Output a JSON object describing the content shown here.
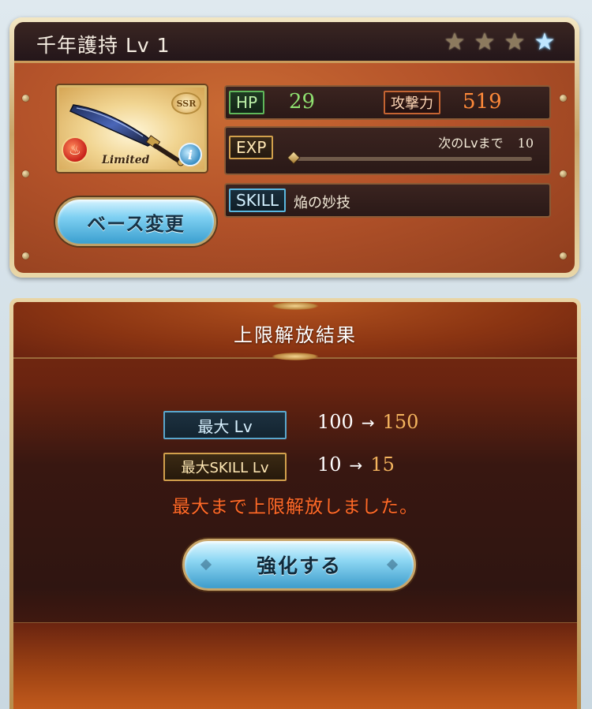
{
  "weapon_card": {
    "name_level": "千年護持 Lv 1",
    "rarity_badge": "SSR",
    "limited_label": "Limited",
    "base_change_label": "ベース変更",
    "stars": [
      {
        "type": "uncap",
        "color": "#8c7a5e"
      },
      {
        "type": "uncap",
        "color": "#8c7a5e"
      },
      {
        "type": "uncap",
        "color": "#8c7a5e"
      },
      {
        "type": "transcend",
        "color": "#bfe6ff"
      }
    ],
    "stats": {
      "hp_label": "HP",
      "hp_value": "29",
      "atk_label": "攻撃力",
      "atk_value": "519",
      "exp_label": "EXP",
      "next_level_label": "次のLvまで",
      "next_level_value": "10",
      "exp_progress": 0.0,
      "skill_label": "SKILL",
      "skill_name": "焔の妙技"
    },
    "element_icon": "fire-icon",
    "info_icon": "info-icon"
  },
  "result_dialog": {
    "title": "上限解放結果",
    "max_level_label": "最大 Lv",
    "max_level_old": "100",
    "max_level_arrow": "→",
    "max_level_new": "150",
    "max_skill_label": "最大SKILL Lv",
    "max_skill_old": "10",
    "max_skill_arrow": "→",
    "max_skill_new": "15",
    "message": "最大まで上限解放しました。",
    "enhance_label": "強化する"
  },
  "colors": {
    "accent_orange": "#ff6a28",
    "new_value": "#f4b45e",
    "hp_green": "#8fe070",
    "atk_orange": "#ff8a3a"
  }
}
